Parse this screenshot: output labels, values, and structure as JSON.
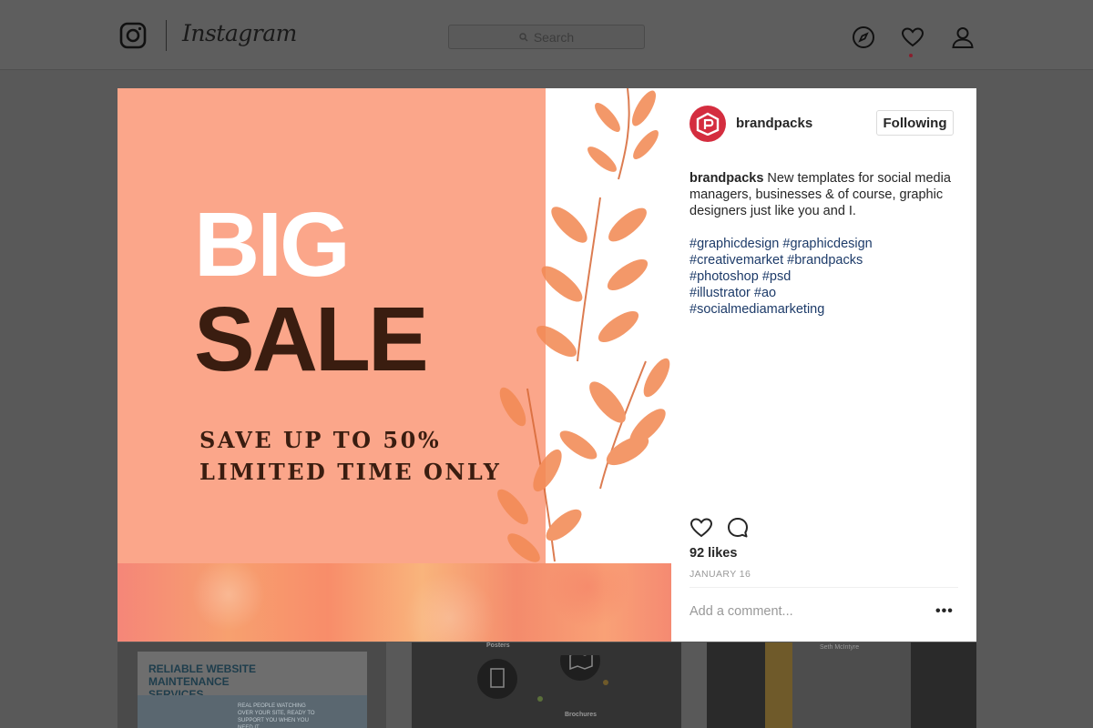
{
  "nav": {
    "brand": "Instagram",
    "search_placeholder": "Search",
    "icons": [
      "instagram-glyph-icon",
      "compass-icon",
      "heart-icon",
      "user-icon"
    ]
  },
  "post": {
    "image": {
      "headline_line1": "BIG",
      "headline_line2": "SALE",
      "promo_line1": "SAVE UP TO 50%",
      "promo_line2": "LIMITED TIME ONLY",
      "colors": {
        "background": "#fba68a",
        "big": "#ffffff",
        "sale": "#3a1d10"
      }
    },
    "author": {
      "username": "brandpacks",
      "follow_label": "Following",
      "avatar_color": "#d42d3f"
    },
    "caption": {
      "username": "brandpacks",
      "text": " New templates for social media managers, businesses & of course, graphic designers just like you and I."
    },
    "hashtag_lines": [
      "#graphicdesign #graphicdesign",
      "#creativemarket #brandpacks",
      "#photoshop #psd",
      "#illustrator #ao",
      "#socialmediamarketing"
    ],
    "likes": "92 likes",
    "date": "JANUARY 16",
    "comment_placeholder": "Add a comment...",
    "more_label": "•••"
  },
  "background_grid": {
    "tile1_title": "RELIABLE WEBSITE MAINTENANCE SERVICES",
    "tile1_text": "REAL PEOPLE WATCHING OVER YOUR SITE, READY TO SUPPORT YOU WHEN YOU NEED IT",
    "tile2_label_top": "Posters",
    "tile2_label_bottom": "Brochures",
    "tile3_name": "Seth McIntyre"
  }
}
